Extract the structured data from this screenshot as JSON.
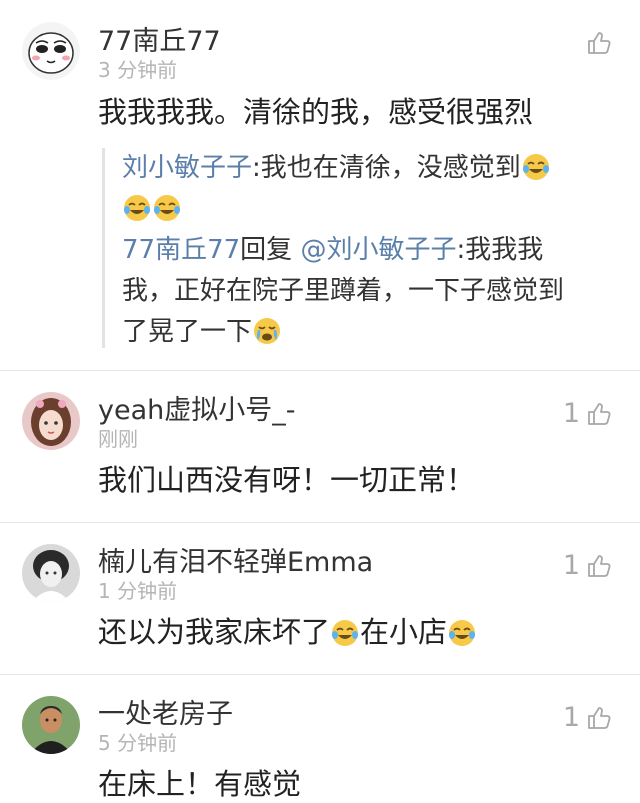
{
  "comments": [
    {
      "user": "77南丘77",
      "time": "3 分钟前",
      "text": "我我我我。清徐的我，感受很强烈",
      "likes": "",
      "avatar": "cartoon-face-avatar"
    },
    {
      "user": "yeah虚拟小号_-",
      "time": "刚刚",
      "text": "我们山西没有呀！一切正常！",
      "likes": "1",
      "avatar": "girl-photo-avatar"
    },
    {
      "user": "楠儿有泪不轻弹Emma",
      "time": "1 分钟前",
      "text_part1": "还以为我家床坏了",
      "text_part2": "在小店",
      "likes": "1",
      "avatar": "bw-portrait-avatar"
    },
    {
      "user": "一处老房子",
      "time": "5 分钟前",
      "text": "在床上！有感觉",
      "likes": "1",
      "avatar": "man-photo-avatar"
    }
  ],
  "replies": {
    "r1_user": "刘小敏子子",
    "r1_text": ":我也在清徐，没感觉到",
    "r2_user": "77南丘77",
    "r2_mid": "回复 ",
    "r2_mention": "@刘小敏子子",
    "r2_text1": ":我我我",
    "r2_text2": "我，正好在院子里蹲着，一下子感觉到",
    "r2_text3": "了晃了一下"
  },
  "colors": {
    "link": "#5b7fab",
    "timestamp": "#b5b5b5",
    "like_icon": "#a8a8a8",
    "divider": "#e6e6e6",
    "emoji_face": "#f7c948"
  },
  "icons": {
    "like": "thumbs-up-icon",
    "emoji": "tears-of-joy-emoji",
    "crying": "crying-emoji"
  }
}
